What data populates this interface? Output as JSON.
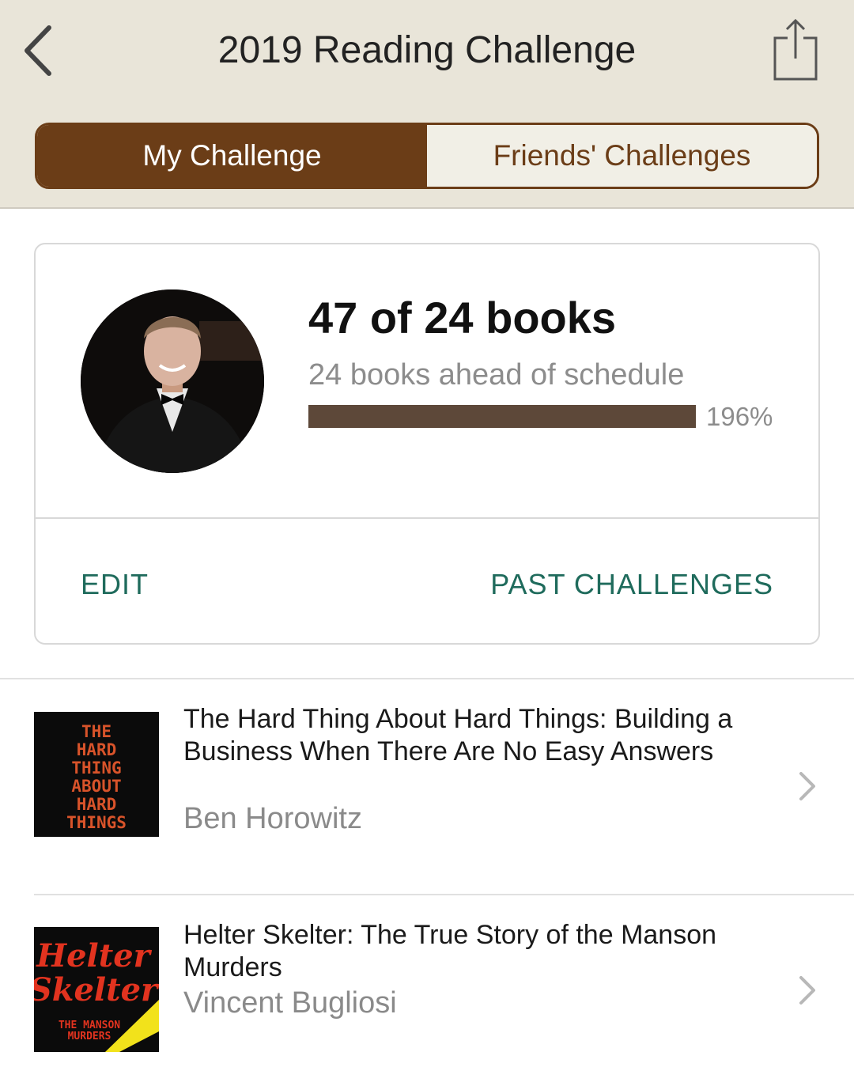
{
  "header": {
    "title": "2019 Reading Challenge",
    "back_icon": "chevron-left-icon",
    "share_icon": "share-icon"
  },
  "tabs": [
    {
      "label": "My Challenge",
      "selected": true
    },
    {
      "label": "Friends' Challenges",
      "selected": false
    }
  ],
  "challenge": {
    "count_text": "47 of 24 books",
    "status_text": "24 books ahead of schedule",
    "percent_text": "196%",
    "progress_fraction": 1.0,
    "edit_label": "EDIT",
    "past_label": "PAST CHALLENGES"
  },
  "books": [
    {
      "title": "The Hard Thing About Hard Things: Building a Business When There Are No Easy Answers",
      "author": "Ben Horowitz",
      "cover_text": [
        "THE",
        "HARD",
        "THING",
        "ABOUT",
        "HARD",
        "THINGS"
      ]
    },
    {
      "title": "Helter Skelter: The True Story of the Manson Murders",
      "author": "Vincent Bugliosi",
      "cover_text": [
        "Helter",
        "Skelter",
        "THE MANSON",
        "MURDERS"
      ]
    }
  ],
  "colors": {
    "header_bg": "#e9e5d9",
    "brand_brown": "#6b3d17",
    "progress": "#5d4839",
    "link_teal": "#1f6b5c"
  }
}
